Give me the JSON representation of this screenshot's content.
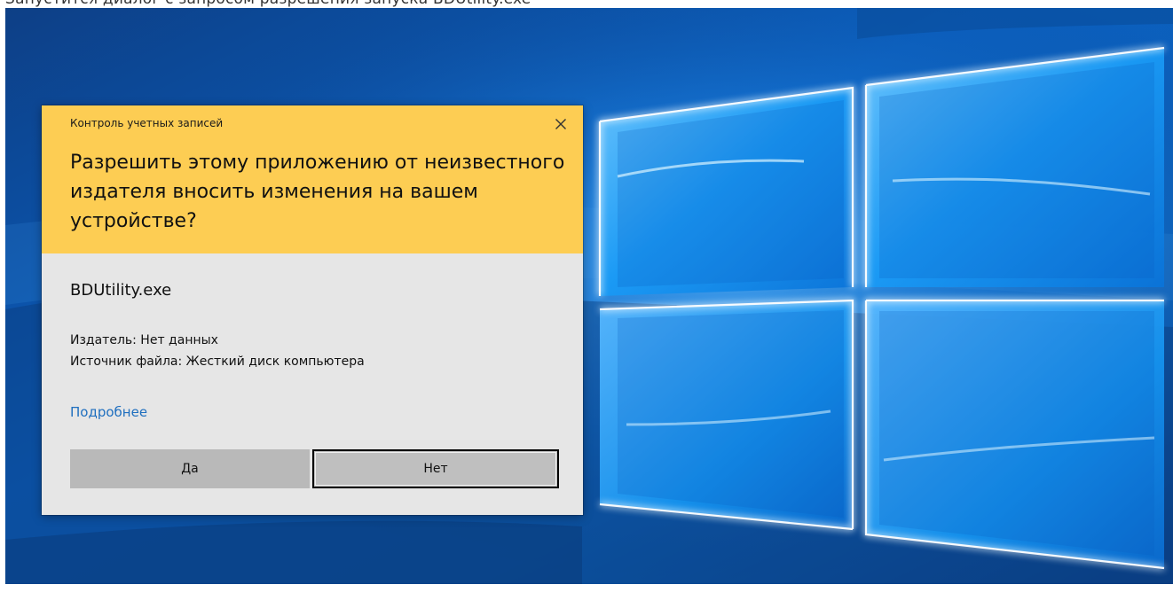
{
  "page_text": "Запустится диалог с запросом разрешения запуска BDUtility.exe",
  "dialog": {
    "title": "Контроль учетных записей",
    "question": "Разрешить этому приложению от неизвестного издателя вносить изменения на вашем устройстве?",
    "app_name": "BDUtility.exe",
    "publisher": "Издатель: Нет данных",
    "source": "Источник файла: Жесткий диск компьютера",
    "more_link": "Подробнее",
    "yes_label": "Да",
    "no_label": "Нет",
    "close_icon": "close-icon"
  },
  "colors": {
    "header": "#fdcd53",
    "dialog_body": "#e6e6e6",
    "button": "#b9b9b9",
    "link": "#1f6fbf",
    "wallpaper": "#0a4d98"
  }
}
